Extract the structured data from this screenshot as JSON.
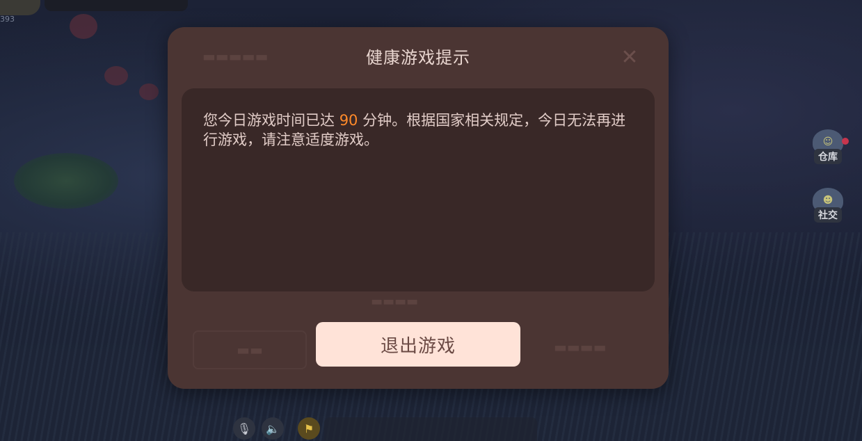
{
  "background": {
    "top_stat": "393",
    "side_buttons": [
      {
        "label": "仓库",
        "icon": "warehouse-mushroom-icon",
        "has_red_dot": true
      },
      {
        "label": "社交",
        "icon": "social-characters-icon",
        "has_red_dot": false
      }
    ],
    "bottom_controls": [
      {
        "icon": "microphone-muted-icon",
        "glyph": "🎙"
      },
      {
        "icon": "speaker-icon",
        "glyph": "🔈"
      },
      {
        "icon": "flag-icon",
        "glyph": "⚑"
      }
    ]
  },
  "modal": {
    "title": "健康游戏提示",
    "message_before": "您今日游戏时间已达 ",
    "minutes": "90",
    "message_after": " 分钟。根据国家相关规定，今日无法再进行游戏，请注意适度游戏。",
    "exit_button": "退出游戏",
    "close_icon": "close-icon"
  },
  "colors": {
    "modal_bg": "#4b3533",
    "message_bg": "#392827",
    "highlight": "#ff8a2a",
    "button_bg": "#ffe3d8",
    "button_text": "#6b4a44"
  }
}
